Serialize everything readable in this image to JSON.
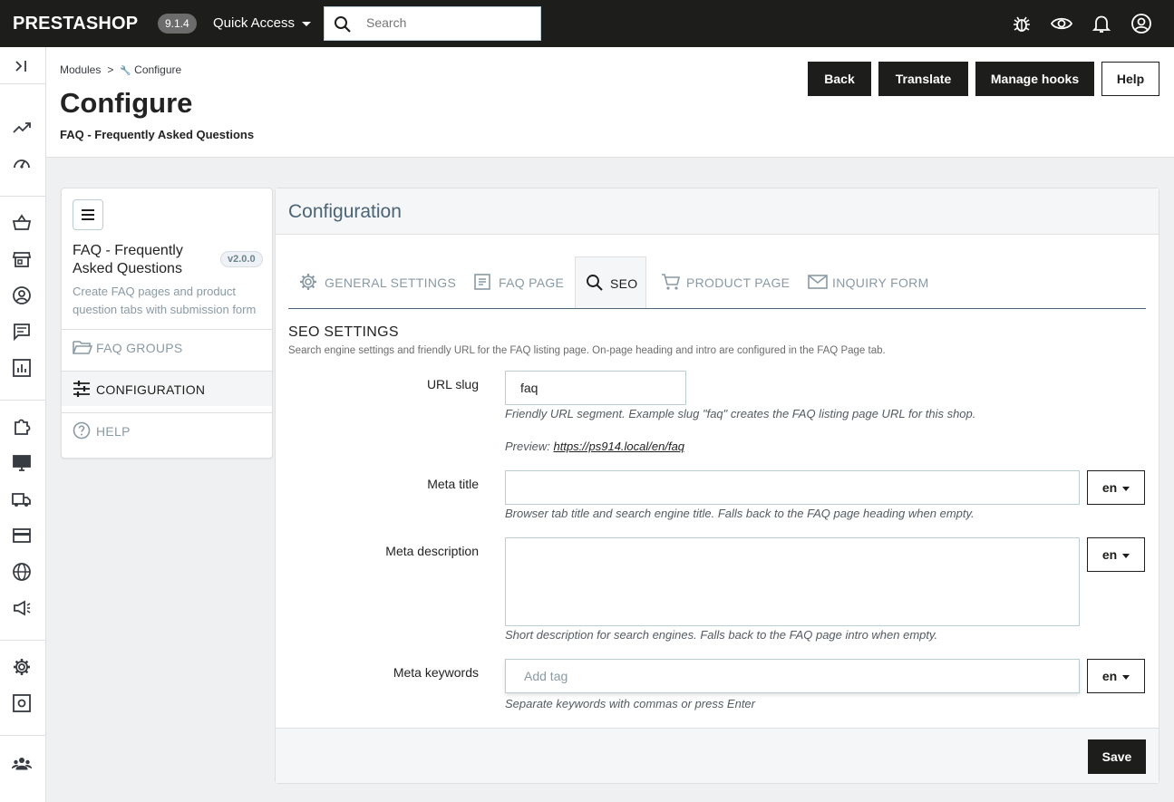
{
  "topbar": {
    "logo": "PRESTASHOP",
    "version": "9.1.4",
    "quick_access": "Quick Access",
    "search_placeholder": "Search"
  },
  "breadcrumb": {
    "parent": "Modules",
    "current": "Configure"
  },
  "page": {
    "title": "Configure",
    "subtitle": "FAQ - Frequently Asked Questions"
  },
  "header_buttons": {
    "back": "Back",
    "translate": "Translate",
    "manage_hooks": "Manage hooks",
    "help": "Help"
  },
  "module": {
    "name": "FAQ - Frequently Asked Questions",
    "version": "v2.0.0",
    "description": "Create FAQ pages and product question tabs with submission form",
    "menu": [
      {
        "label": "FAQ GROUPS",
        "icon": "folder-icon",
        "active": false
      },
      {
        "label": "CONFIGURATION",
        "icon": "sliders-icon",
        "active": true
      },
      {
        "label": "HELP",
        "icon": "help-circle-icon",
        "active": false
      }
    ]
  },
  "panel": {
    "title": "Configuration",
    "tabs": [
      {
        "label": "GENERAL SETTINGS",
        "icon": "gear-icon"
      },
      {
        "label": "FAQ PAGE",
        "icon": "document-icon"
      },
      {
        "label": "SEO",
        "icon": "search-icon",
        "active": true
      },
      {
        "label": "PRODUCT PAGE",
        "icon": "cart-icon"
      },
      {
        "label": "INQUIRY FORM",
        "icon": "mail-icon"
      }
    ],
    "section_title": "SEO SETTINGS",
    "section_desc": "Search engine settings and friendly URL for the FAQ listing page. On-page heading and intro are configured in the FAQ Page tab.",
    "fields": {
      "url_slug": {
        "label": "URL slug",
        "value": "faq",
        "help": "Friendly URL segment. Example slug \"faq\" creates the FAQ listing page URL for this shop.",
        "preview_label": "Preview:",
        "preview_url": "https://ps914.local/en/faq"
      },
      "meta_title": {
        "label": "Meta title",
        "value": "",
        "lang": "en",
        "help": "Browser tab title and search engine title. Falls back to the FAQ page heading when empty."
      },
      "meta_description": {
        "label": "Meta description",
        "value": "",
        "lang": "en",
        "help": "Short description for search engines. Falls back to the FAQ page intro when empty."
      },
      "meta_keywords": {
        "label": "Meta keywords",
        "placeholder": "Add tag",
        "lang": "en",
        "help": "Separate keywords with commas or press Enter"
      }
    },
    "save": "Save"
  }
}
